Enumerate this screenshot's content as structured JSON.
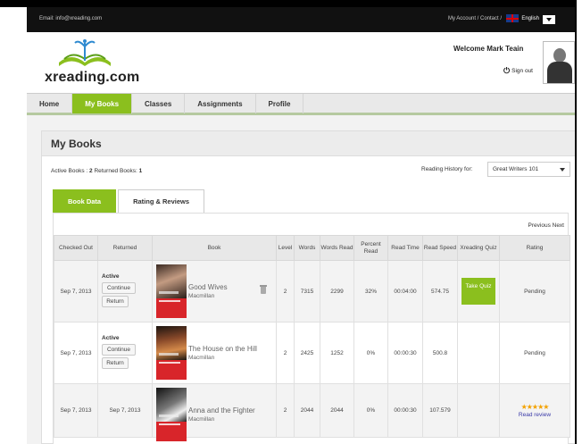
{
  "topbar": {
    "email": "Email: info@xreading.com",
    "links": "My Account / Contact /",
    "language": "English"
  },
  "header": {
    "logo_text": "xreading.com",
    "welcome": "Welcome Mark Teain",
    "sign_out": "Sign out"
  },
  "nav": {
    "items": [
      {
        "label": "Home"
      },
      {
        "label": "My Books"
      },
      {
        "label": "Classes"
      },
      {
        "label": "Assignments"
      },
      {
        "label": "Profile"
      }
    ]
  },
  "page": {
    "title": "My Books",
    "active_books_label": "Active Books :",
    "active_books_count": "2",
    "returned_books_label": "Returned Books:",
    "returned_books_count": "1",
    "reading_history_label": "Reading History for:",
    "reading_history_value": "Great Writers 101"
  },
  "tabs": [
    {
      "label": "Book Data"
    },
    {
      "label": "Rating & Reviews"
    }
  ],
  "pager": "Previous Next",
  "table": {
    "headers": [
      "Checked Out",
      "Returned",
      "Book",
      "Level",
      "Words",
      "Words Read",
      "Percent Read",
      "Read Time",
      "Read Speed",
      "Xreading Quiz",
      "Rating"
    ],
    "rows": [
      {
        "checked_out": "Sep 7, 2013",
        "status": "Active",
        "continue_label": "Continue",
        "return_label": "Return",
        "title": "Good Wives",
        "publisher": "Macmillan",
        "level": "2",
        "words": "7315",
        "words_read": "2299",
        "percent_read": "32%",
        "read_time": "00:04:00",
        "read_speed": "574.75",
        "quiz_label": "Take Quiz",
        "rating": "Pending"
      },
      {
        "checked_out": "Sep 7, 2013",
        "status": "Active",
        "continue_label": "Continue",
        "return_label": "Return",
        "title": "The House on the Hill",
        "publisher": "Macmillan",
        "level": "2",
        "words": "2425",
        "words_read": "1252",
        "percent_read": "0%",
        "read_time": "00:00:30",
        "read_speed": "500.8",
        "rating": "Pending"
      },
      {
        "checked_out": "Sep 7, 2013",
        "returned": "Sep 7, 2013",
        "title": "Anna and the Fighter",
        "publisher": "Macmillan",
        "level": "2",
        "words": "2044",
        "words_read": "2044",
        "percent_read": "0%",
        "read_time": "00:00:30",
        "read_speed": "107.579",
        "stars": "★★★★★",
        "read_review": "Read review"
      }
    ]
  },
  "colors": {
    "accent_green": "#8bbf1e",
    "link_blue": "#3a3aa8",
    "star_orange": "#f3a200",
    "cover_red": "#d8252a"
  }
}
